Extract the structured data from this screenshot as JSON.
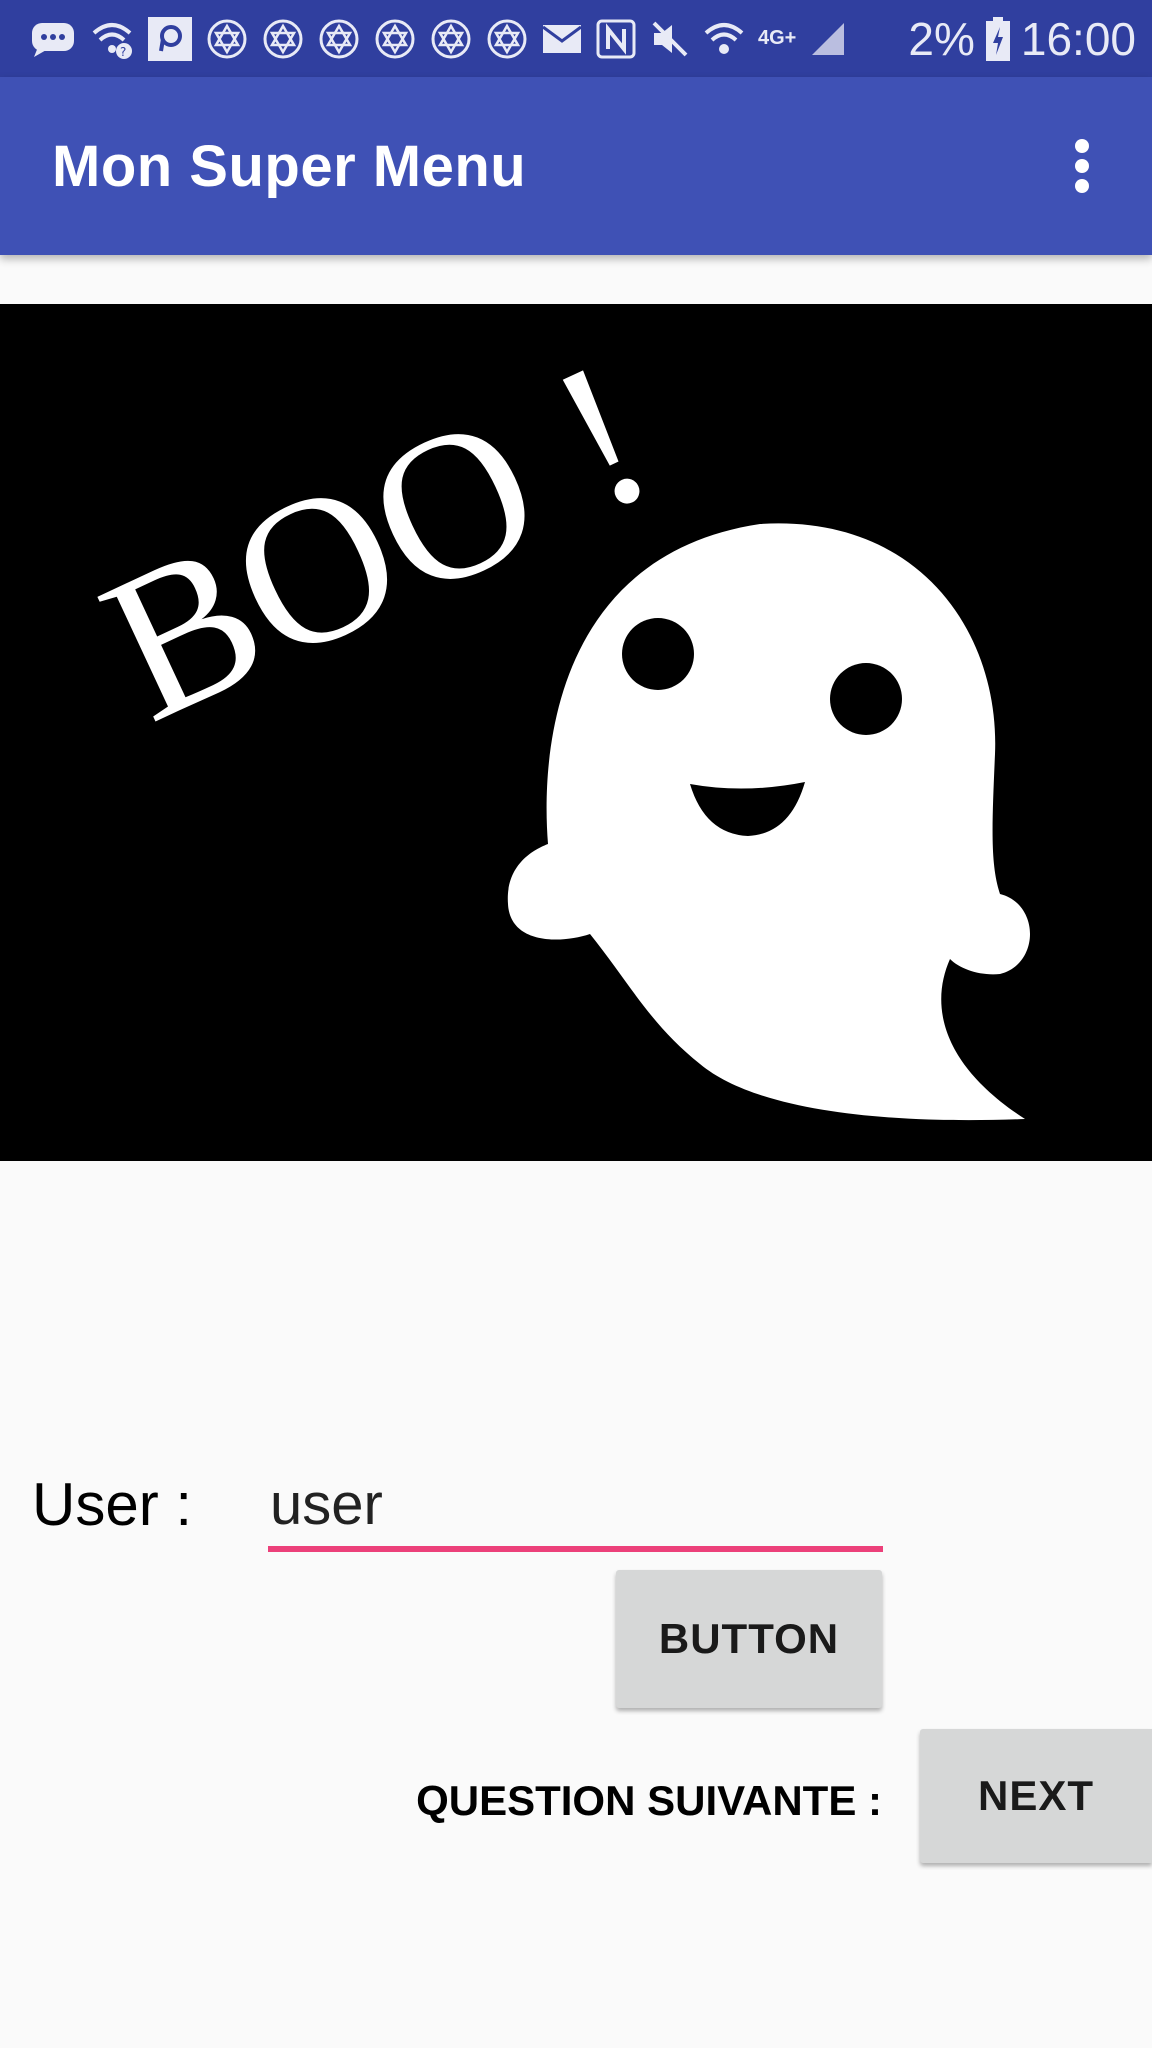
{
  "status_bar": {
    "battery": "2%",
    "time": "16:00",
    "network": "4G+",
    "icons": [
      "message-icon",
      "wifi-question-icon",
      "p-app-icon",
      "star-of-david-icon",
      "star-of-david-icon",
      "star-of-david-icon",
      "star-of-david-icon",
      "star-of-david-icon",
      "star-of-david-icon",
      "mail-icon",
      "nfc-icon",
      "mute-icon",
      "wifi-icon",
      "signal-icon",
      "battery-charging-icon"
    ]
  },
  "app_bar": {
    "title": "Mon Super Menu",
    "overflow_icon": "more-vert-icon",
    "color": "#3f51b5",
    "status_color": "#303f9f"
  },
  "hero": {
    "text": "BOO !",
    "description_icon": "ghost-icon"
  },
  "form": {
    "user_label": "User :",
    "user_value": "user",
    "button_label": "BUTTON",
    "question_label": "QUESTION SUIVANTE :",
    "next_label": "NEXT",
    "accent_color": "#ec407a"
  }
}
